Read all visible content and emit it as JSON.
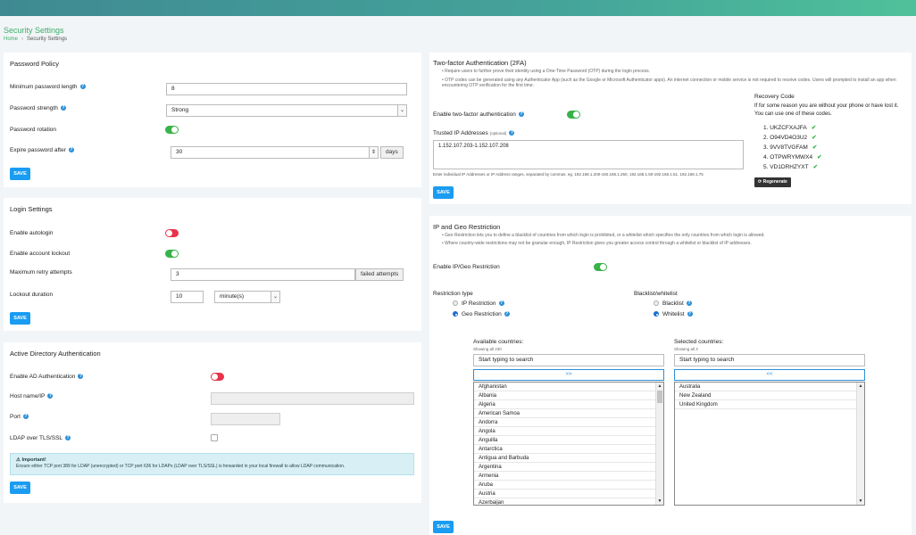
{
  "page": {
    "title": "Security Settings",
    "breadcrumb": {
      "home": "Home",
      "current": "Security Settings"
    }
  },
  "password_policy": {
    "title": "Password Policy",
    "min_length_label": "Minimum password length",
    "min_length_value": "8",
    "strength_label": "Password strength",
    "strength_value": "Strong",
    "rotation_label": "Password rotation",
    "expire_label": "Expire password after",
    "expire_value": "30",
    "expire_unit": "days",
    "save": "SAVE"
  },
  "login_settings": {
    "title": "Login Settings",
    "autologin_label": "Enable autologin",
    "lockout_label": "Enable account lockout",
    "max_retry_label": "Maximum retry attempts",
    "max_retry_value": "3",
    "max_retry_unit": "failed attempts",
    "lockout_duration_label": "Lockout duration",
    "lockout_duration_value": "10",
    "lockout_duration_unit": "minute(s)",
    "save": "SAVE"
  },
  "ad_auth": {
    "title": "Active Directory Authentication",
    "enable_label": "Enable AD Authentication",
    "host_label": "Host name/IP",
    "port_label": "Port",
    "ldaps_label": "LDAP over TLS/SSL",
    "notice_title": "Important!",
    "notice_text": "Ensure either TCP port 389 for LDAP (unencrypted) or TCP port 636 for LDAPs (LDAP over TLS/SSL) is forwarded in your local firewall to allow LDAP communication.",
    "save": "SAVE"
  },
  "twofa": {
    "title": "Two-factor Authentication (2FA)",
    "bullet1": "Require users to further prove their identity using a One-Time Password (OTP) during the login process.",
    "bullet2": "OTP codes can be generated using any Authenticator App (such as the Google or Microsoft Authenticator apps). An internet connection or mobile service is not required to receive codes. Users will prompted to install an app when encountering OTP verification for the first time.",
    "enable_label": "Enable two-factor authentication",
    "trusted_ip_label": "Trusted IP Addresses",
    "trusted_ip_optional": "(optional)",
    "trusted_ip_value": "1.152.107.203-1.152.107.208",
    "trusted_ip_hint": "Enter individual IP Addresses or IP Address ranges, separated by commas. eg. 192.168.1.200-192.168.1.250, 192.168.1.50-192.168.1.51, 192.168.1.75",
    "save": "SAVE",
    "recovery": {
      "title": "Recovery Code",
      "desc1": "If for some reason you are without your phone or have lost it.",
      "desc2": "You can use one of these codes.",
      "codes": [
        "1. UKZCFXAJFA",
        "2. O94VD4O3U2",
        "3. 9VV8TVGFAM",
        "4. OTPWRYMWX4",
        "5. VD1DRHZYXT"
      ],
      "regenerate": "Regenerate"
    }
  },
  "geo": {
    "title": "IP and Geo Restriction",
    "bullet1": "Geo Restriction lets you to define a blacklist of countries from which login is prohibited, or a whitelist which specifies the only countries from which login is allowed.",
    "bullet2": "Where country-wide restrictions may not be granular enough, IP Restriction gives you greater access control through a whitelist or blacklist of IP addresses.",
    "enable_label": "Enable IP/Geo Restriction",
    "restriction_type_label": "Restriction type",
    "ip_restriction": "IP Restriction",
    "geo_restriction": "Geo Restriction",
    "bw_label": "Blacklist/whitelist",
    "blacklist": "Blacklist",
    "whitelist": "Whitelist",
    "available_label": "Available countries:",
    "available_count": "Showing all 230",
    "selected_label": "Selected countries:",
    "selected_count": "Showing all 3",
    "search_placeholder": "Start typing to search",
    "move_right": ">>",
    "move_left": "<<",
    "available": [
      "Afghanistan",
      "Albania",
      "Algeria",
      "American Samoa",
      "Andorra",
      "Angola",
      "Anguilla",
      "Antarctica",
      "Antigua and Barbuda",
      "Argentina",
      "Armenia",
      "Aruba",
      "Austria",
      "Azerbaijan"
    ],
    "selected": [
      "Australia",
      "New Zealand",
      "United Kingdom"
    ],
    "save": "SAVE"
  }
}
